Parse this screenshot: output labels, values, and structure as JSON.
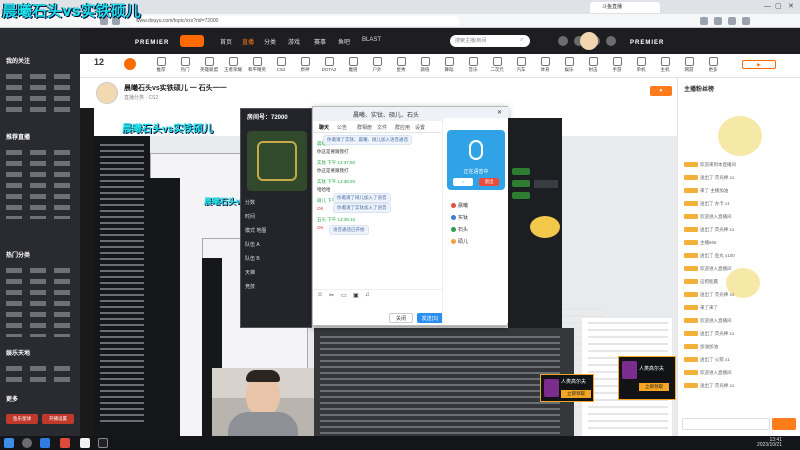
{
  "overlay": {
    "title": "晨曦石头vs实铁硕儿"
  },
  "browser": {
    "url": "www.douyu.com/topic/xxx?rid=72000",
    "tab_title": "斗鱼直播"
  },
  "site_header": {
    "brand": "PREMIER",
    "brand_right": "PREMIER",
    "nav": [
      "首页",
      "直播",
      "分类",
      "游戏",
      "赛事",
      "鱼吧",
      "BLAST"
    ],
    "search_placeholder": "搜索主播/房间"
  },
  "sidebar": {
    "sections": [
      {
        "title": "我的关注"
      },
      {
        "title": "推荐直播"
      },
      {
        "title": "热门分类"
      },
      {
        "title": "娱乐天地"
      },
      {
        "title": "更多"
      }
    ],
    "footer_buttons": [
      "鱼乐星球",
      "开播设置"
    ]
  },
  "categories": [
    "推荐",
    "热门",
    "英雄联盟",
    "王者荣耀",
    "和平精英",
    "CS2",
    "原神",
    "DOTA2",
    "魔兽",
    "户外",
    "星秀",
    "颜值",
    "舞蹈",
    "音乐",
    "二次元",
    "汽车",
    "体育",
    "娱乐",
    "射击",
    "手游",
    "单机",
    "主机",
    "网游",
    "更多"
  ],
  "room": {
    "counter": "12",
    "title": "晨曦石头vs实铁硕儿 一 石头一一",
    "subtitle": "直播分类 · CS2"
  },
  "game_panel": {
    "header": "房间号：72000",
    "rows": [
      "分数",
      "时间",
      "模式 地图",
      "队伍 A",
      "队伍 B",
      "天梯",
      "竞技"
    ]
  },
  "chat_window": {
    "title": "晨曦、实钛、硕儿、石头",
    "tabs": [
      "聊天",
      "公告",
      "群相册",
      "文件",
      "群应用",
      "设置"
    ],
    "messages": [
      {
        "kind": "g",
        "text": "晨曦 下午 13:37:14"
      },
      {
        "kind": "b",
        "text": "你这是要跟我打"
      },
      {
        "kind": "g",
        "text": "实钛 下午 13:37:50"
      },
      {
        "kind": "b",
        "text": "你这是要跟我打"
      },
      {
        "kind": "g",
        "text": "实钛 下午 13:38:20"
      },
      {
        "kind": "b",
        "text": "哈哈哈"
      },
      {
        "kind": "g",
        "text": "硕儿 下午 13:38:46"
      },
      {
        "kind": "r",
        "text": "OK"
      },
      {
        "kind": "g",
        "text": "石头 下午 13:39:10"
      },
      {
        "kind": "r",
        "text": "OK"
      }
    ],
    "bubbles": [
      "你邀请了实钛、晨曦、硕儿加入语音通话",
      "你邀请了硕儿加入了语音",
      "你邀请了实钛加入了语音",
      "语音通话已开始"
    ],
    "button_close": "关闭",
    "button_send": "发送(S)"
  },
  "voice_panel": {
    "status": "正在语音中",
    "members": [
      {
        "name": "晨曦",
        "color": "#e84c3d"
      },
      {
        "name": "实钛",
        "color": "#3b7dd8"
      },
      {
        "name": "石头",
        "color": "#2e9b4e"
      },
      {
        "name": "硕儿",
        "color": "#f2a33a"
      }
    ],
    "leave": "退出"
  },
  "right_col": {
    "heading": "主播粉丝榜",
    "messages": [
      "欢迎来到本直播间",
      "送出了 荧光棒 x1",
      "来了 主播加油",
      "送出了 办卡 x1",
      "欢迎进入直播间",
      "送出了 荧光棒 x1",
      "主播666",
      "送出了 鱼丸 x100",
      "欢迎进入直播间",
      "这把能赢",
      "送出了 荧光棒 x1",
      "来了来了",
      "欢迎进入直播间",
      "送出了 荧光棒 x1",
      "加油加油",
      "送出了 火箭 x1",
      "欢迎进入直播间",
      "送出了 荧光棒 x1"
    ]
  },
  "promo": {
    "title": "人类高尔夫",
    "button": "立即领取"
  },
  "taskbar": {
    "time": "13:41",
    "date": "2023/10/21"
  }
}
